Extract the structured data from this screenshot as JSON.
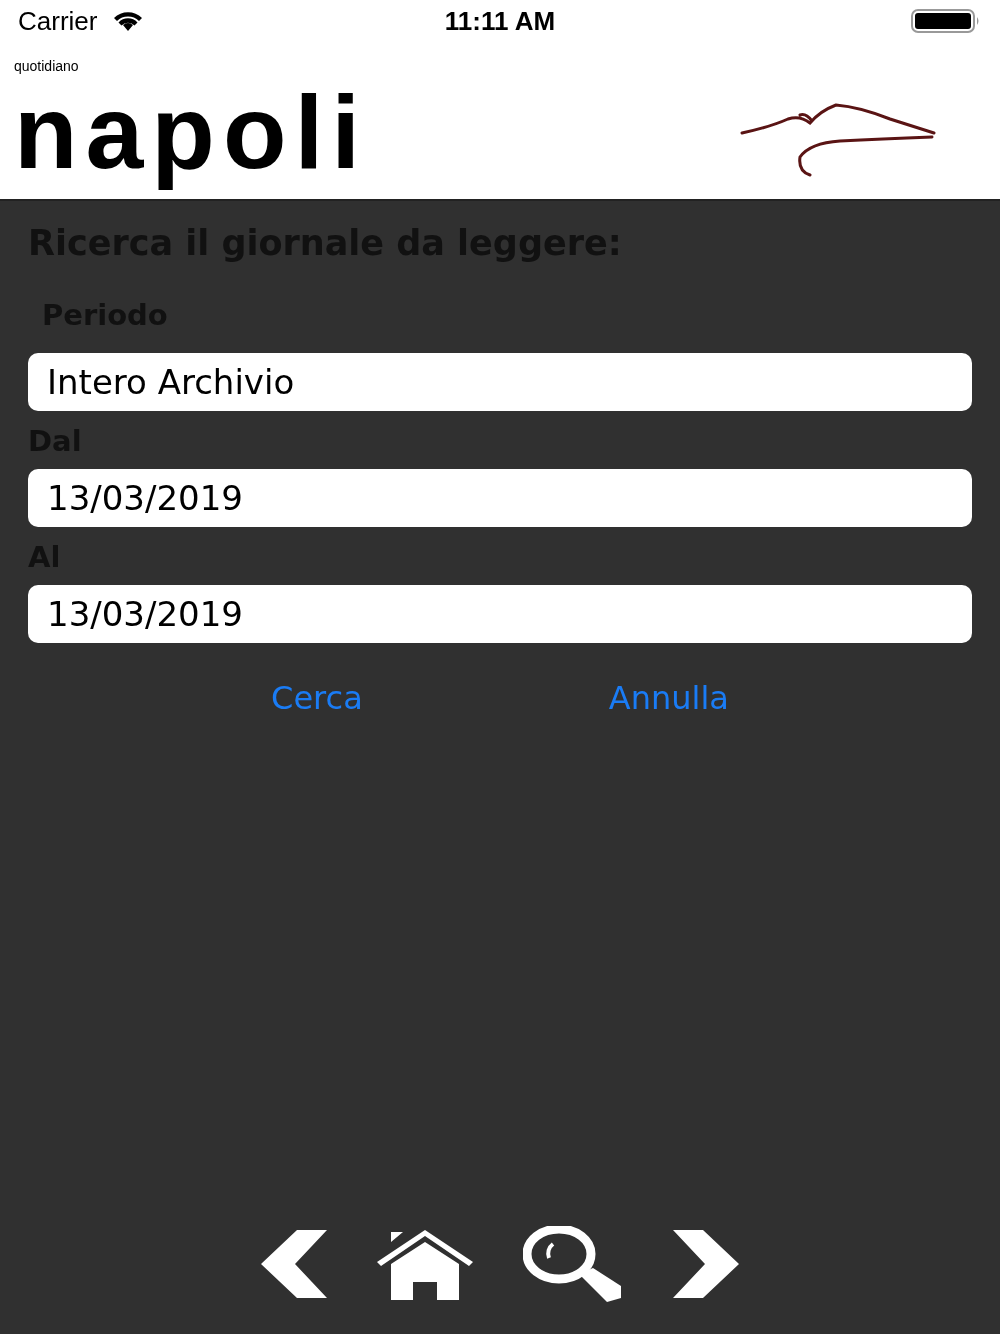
{
  "status_bar": {
    "carrier": "Carrier",
    "time": "11:11 AM"
  },
  "header": {
    "logo_small": "quotidiano",
    "logo_big": "napoli"
  },
  "title": "Ricerca il giornale da leggere:",
  "fields": [
    {
      "kind": "period",
      "label": "Periodo",
      "value": "Intero Archivio"
    },
    {
      "kind": "date",
      "label": "Dal",
      "value": "13/03/2019"
    },
    {
      "kind": "date",
      "label": "Al",
      "value": "13/03/2019"
    }
  ],
  "buttons": [
    {
      "label": "Cerca"
    },
    {
      "label": "Annulla"
    }
  ]
}
